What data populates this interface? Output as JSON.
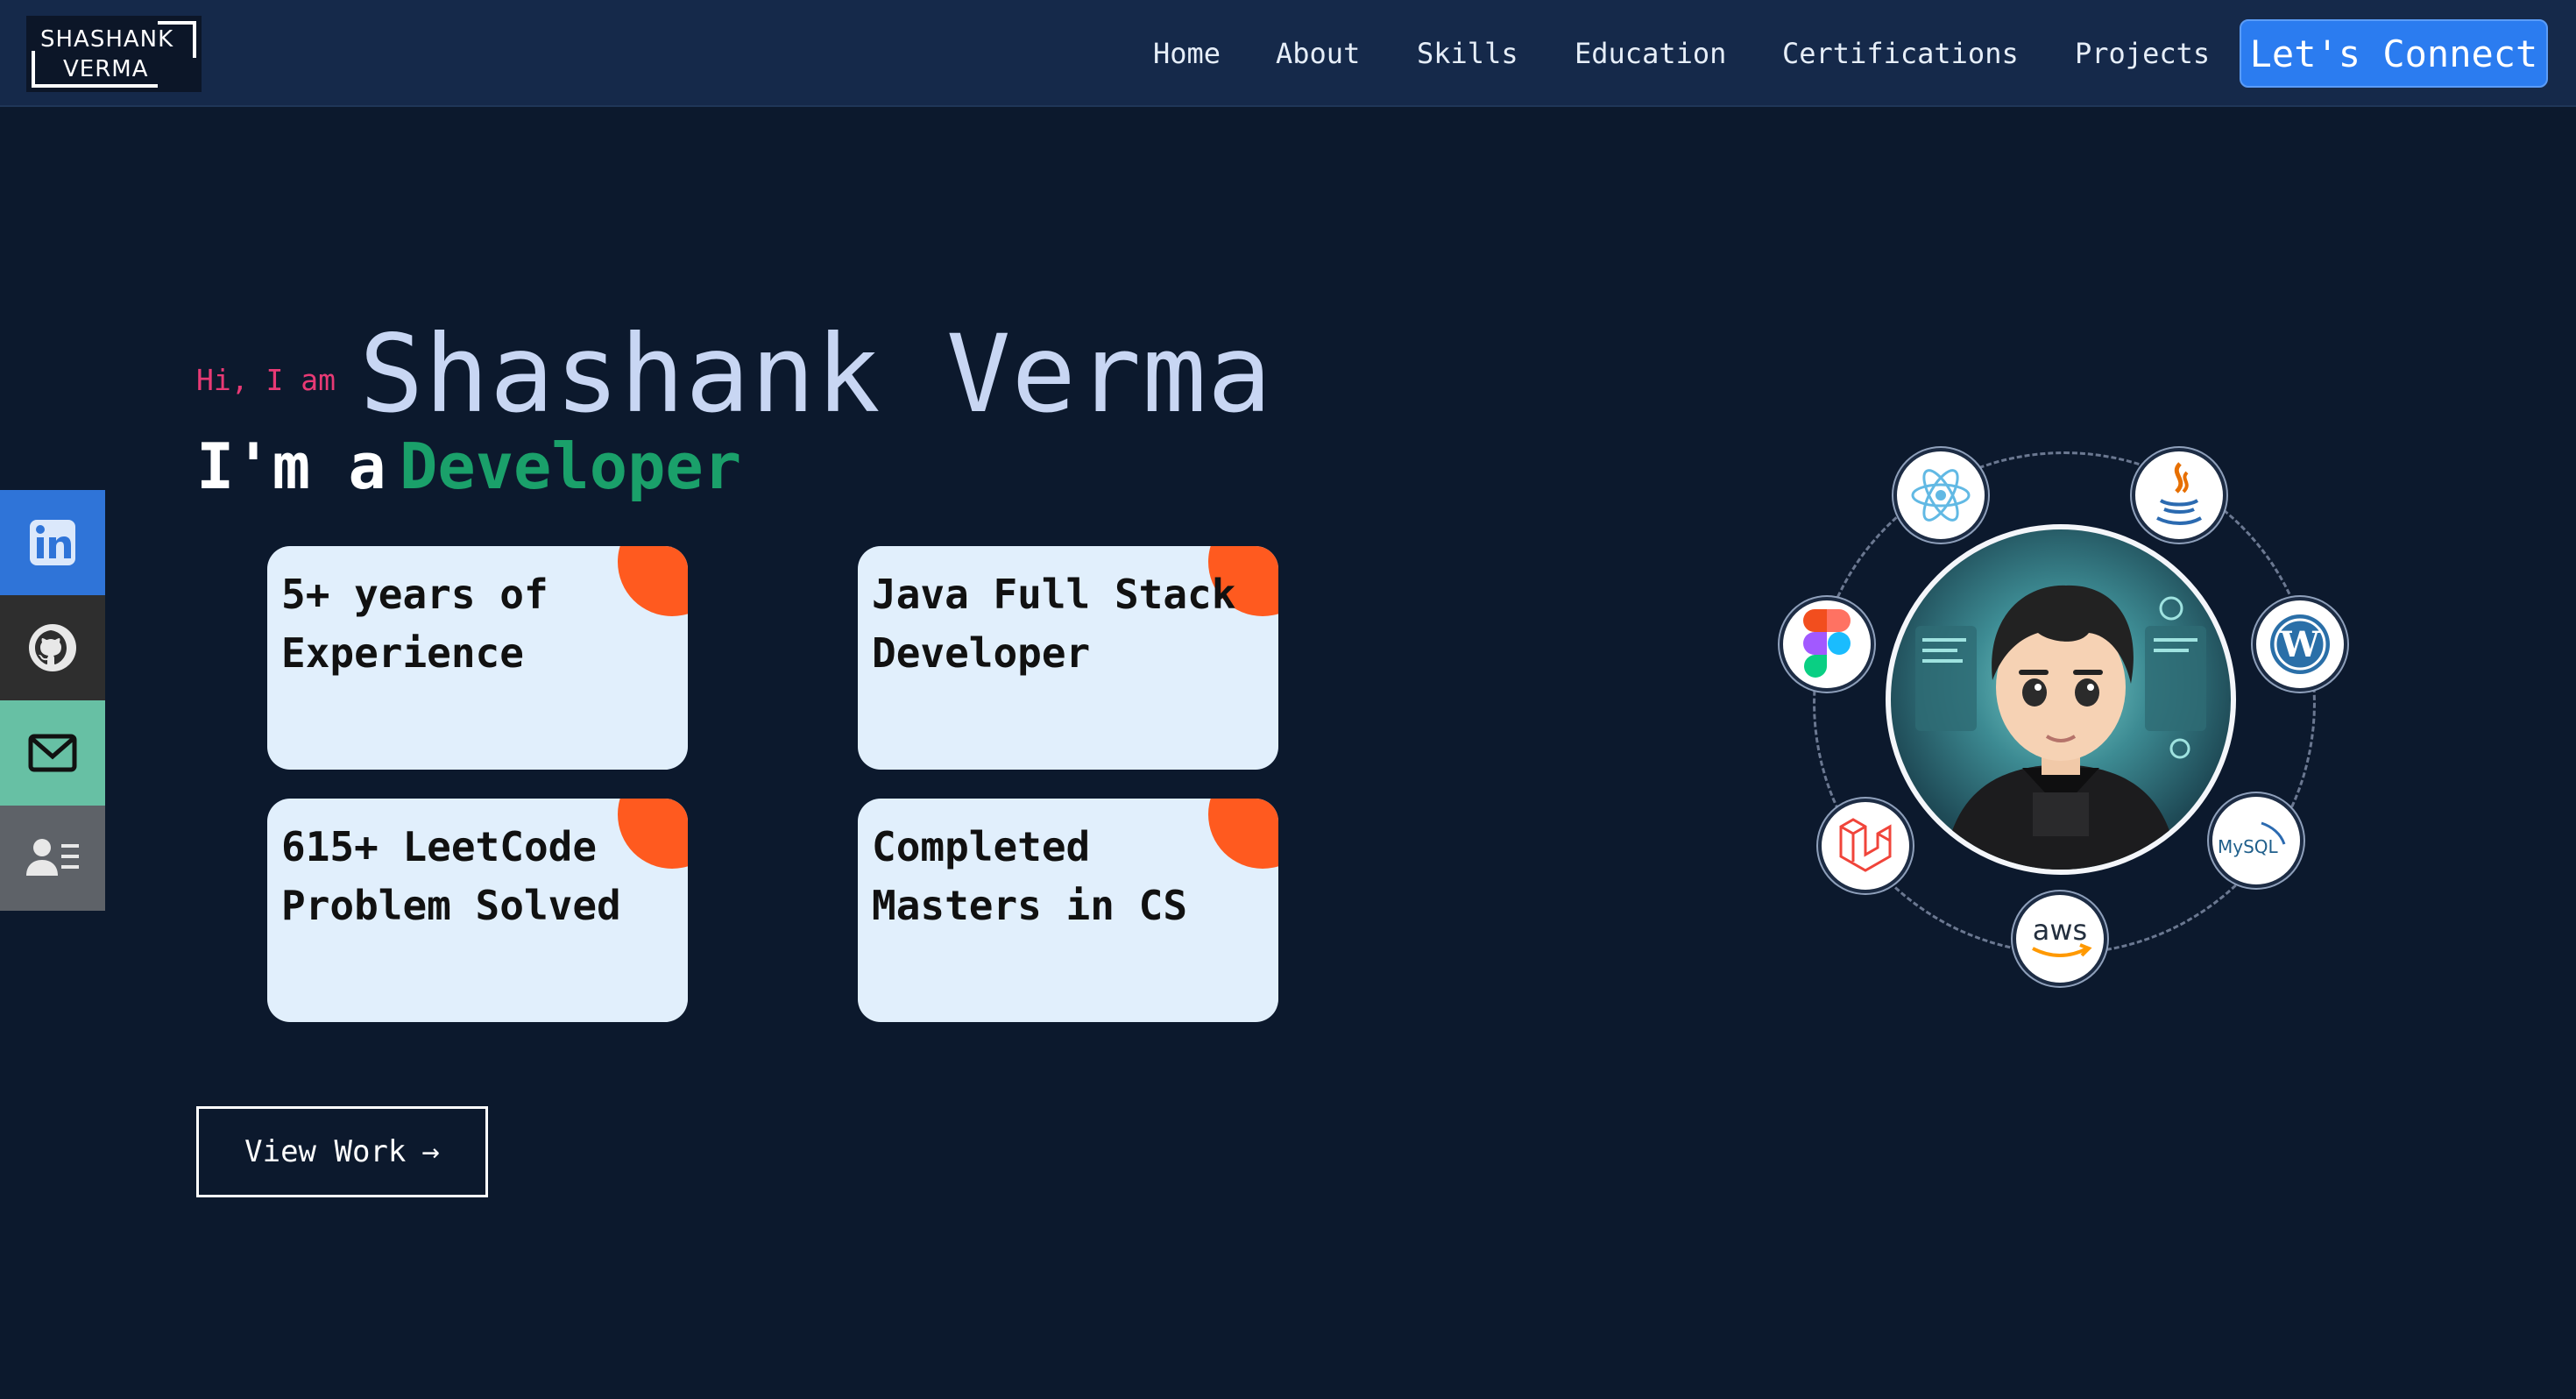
{
  "navbar": {
    "logo_line1": "SHASHANK",
    "logo_line2": "VERMA",
    "links": [
      {
        "label": "Home"
      },
      {
        "label": "About"
      },
      {
        "label": "Skills"
      },
      {
        "label": "Education"
      },
      {
        "label": "Certifications"
      },
      {
        "label": "Projects"
      }
    ],
    "cta_label": "Let's Connect"
  },
  "social": [
    {
      "name": "linkedin-icon",
      "color": "#2f74d8"
    },
    {
      "name": "github-icon",
      "color": "#2e2e2e"
    },
    {
      "name": "mail-icon",
      "color": "#67c0a4"
    },
    {
      "name": "resume-icon",
      "color": "#5e6268"
    }
  ],
  "hero": {
    "greeting": "Hi, I am",
    "name": "Shashank Verma",
    "prefix": "I'm a",
    "role": "Developer",
    "cards": [
      {
        "text": "5+ years of\nExperience"
      },
      {
        "text": "Java Full Stack\nDeveloper"
      },
      {
        "text": "615+ LeetCode\nProblem Solved"
      },
      {
        "text": "Completed\nMasters in CS"
      }
    ],
    "view_work_label": "View Work",
    "view_work_arrow": "→"
  },
  "tech_stack": [
    {
      "name": "react-icon"
    },
    {
      "name": "java-icon"
    },
    {
      "name": "wordpress-icon"
    },
    {
      "name": "mysql-icon",
      "label": "MySQL"
    },
    {
      "name": "aws-icon",
      "label": "aws"
    },
    {
      "name": "laravel-icon"
    },
    {
      "name": "figma-icon"
    }
  ],
  "colors": {
    "background": "#0c192d",
    "navbar": "#15294a",
    "accent_blue": "#2b7cf0",
    "greeting_pink": "#e83a75",
    "role_green": "#1aa06a",
    "card_bg": "#e1effc",
    "card_corner": "#ff5a1f"
  }
}
